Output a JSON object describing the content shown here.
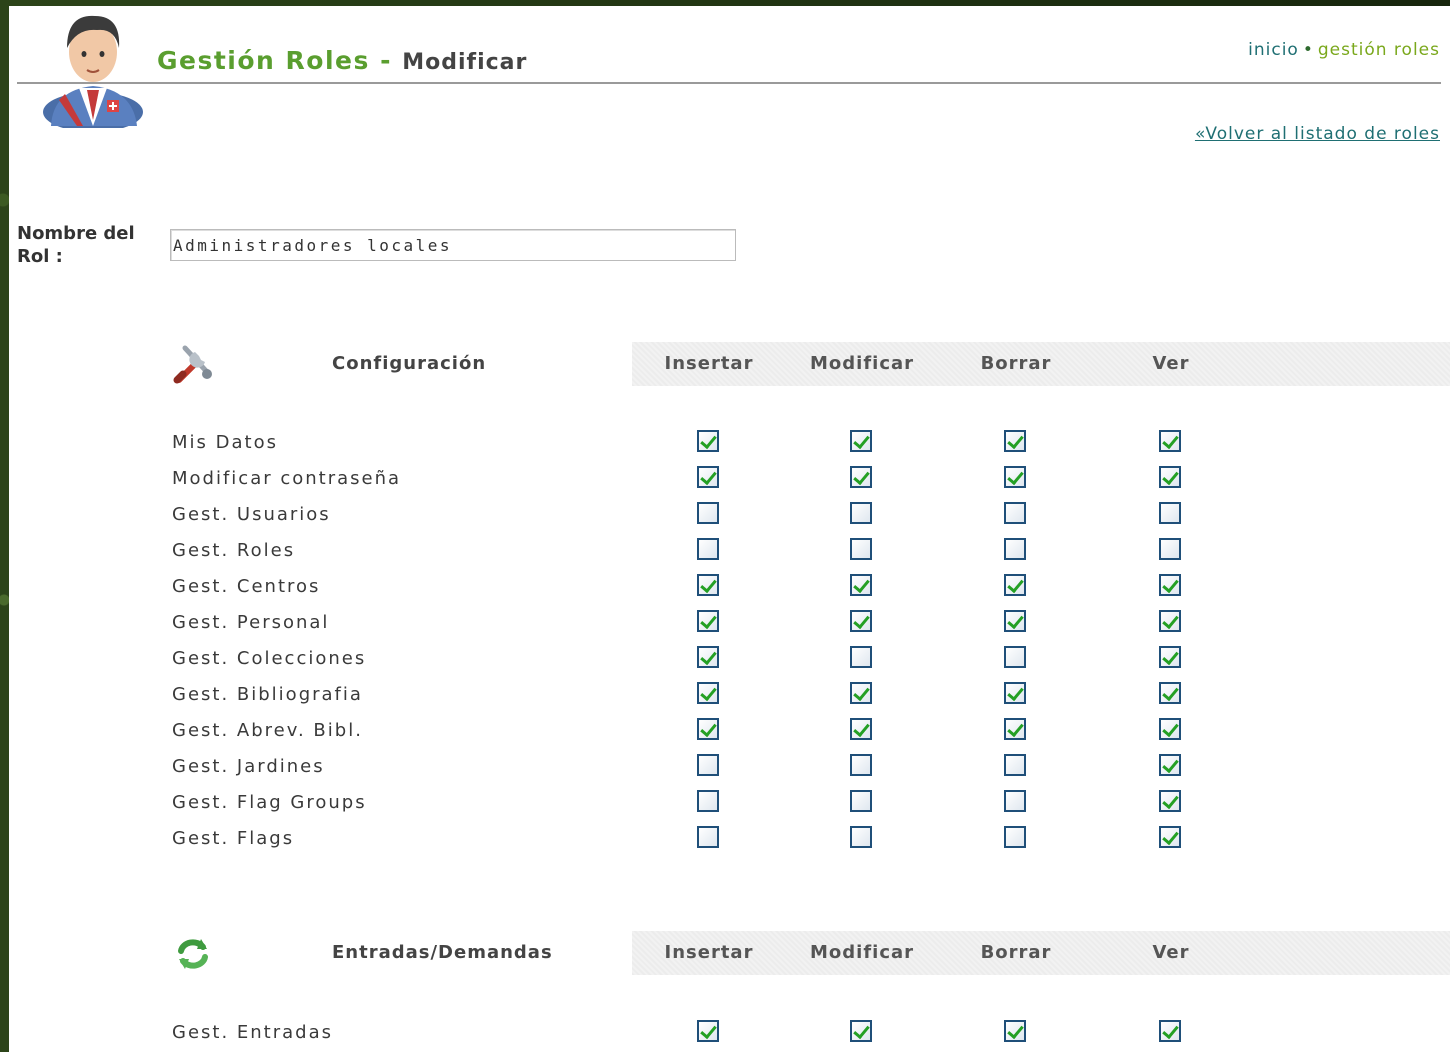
{
  "header": {
    "title_main": "Gestión Roles",
    "title_sep": "-",
    "title_sub": "Modificar",
    "breadcrumb_home": "inicio",
    "breadcrumb_sep": "•",
    "breadcrumb_current": "gestión roles",
    "back_link": "«Volver al listado de roles"
  },
  "form": {
    "name_label": "Nombre del Rol :",
    "name_value": "Administradores locales"
  },
  "columns": [
    "Insertar",
    "Modificar",
    "Borrar",
    "Ver"
  ],
  "sections": [
    {
      "title": "Configuración",
      "icon": "tools-icon",
      "rows": [
        {
          "label": "Mis Datos",
          "checks": [
            true,
            true,
            true,
            true
          ]
        },
        {
          "label": "Modificar contraseña",
          "checks": [
            true,
            true,
            true,
            true
          ]
        },
        {
          "label": "Gest. Usuarios",
          "checks": [
            false,
            false,
            false,
            false
          ]
        },
        {
          "label": "Gest. Roles",
          "checks": [
            false,
            false,
            false,
            false
          ]
        },
        {
          "label": "Gest. Centros",
          "checks": [
            true,
            true,
            true,
            true
          ]
        },
        {
          "label": "Gest. Personal",
          "checks": [
            true,
            true,
            true,
            true
          ]
        },
        {
          "label": "Gest. Colecciones",
          "checks": [
            true,
            false,
            false,
            true
          ]
        },
        {
          "label": "Gest. Bibliografia",
          "checks": [
            true,
            true,
            true,
            true
          ]
        },
        {
          "label": "Gest. Abrev. Bibl.",
          "checks": [
            true,
            true,
            true,
            true
          ]
        },
        {
          "label": "Gest. Jardines",
          "checks": [
            false,
            false,
            false,
            true
          ]
        },
        {
          "label": "Gest. Flag Groups",
          "checks": [
            false,
            false,
            false,
            true
          ]
        },
        {
          "label": "Gest. Flags",
          "checks": [
            false,
            false,
            false,
            true
          ]
        }
      ]
    },
    {
      "title": "Entradas/Demandas",
      "icon": "refresh-icon",
      "rows": [
        {
          "label": "Gest. Entradas",
          "checks": [
            true,
            true,
            true,
            true
          ]
        }
      ]
    }
  ],
  "colors": {
    "title_green": "#5a9e2f",
    "link_teal": "#1f6f73",
    "check_green": "#24a024",
    "checkbox_border": "#1f4f79"
  }
}
